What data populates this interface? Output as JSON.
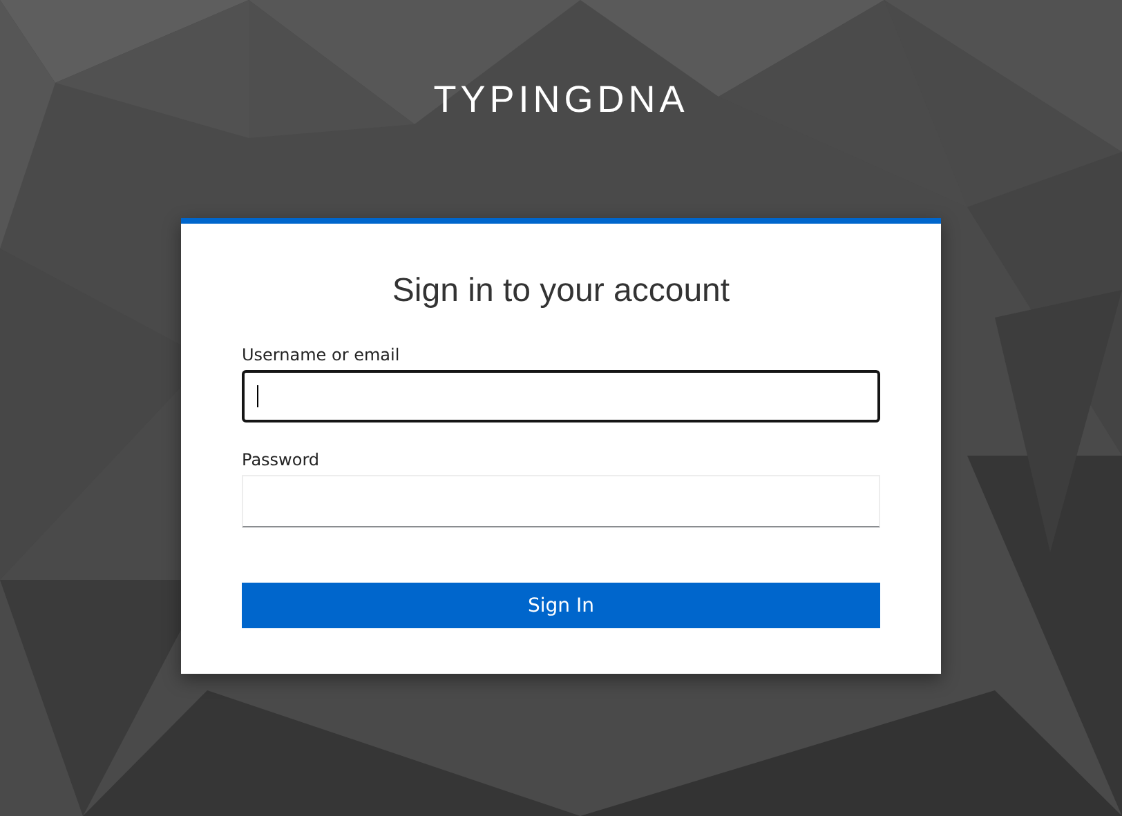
{
  "brand": {
    "title": "TYPINGDNA"
  },
  "login": {
    "heading": "Sign in to your account",
    "fields": [
      {
        "label": "Username or email",
        "focused": true
      },
      {
        "label": "Password",
        "focused": false
      }
    ],
    "submit": "Sign In"
  }
}
